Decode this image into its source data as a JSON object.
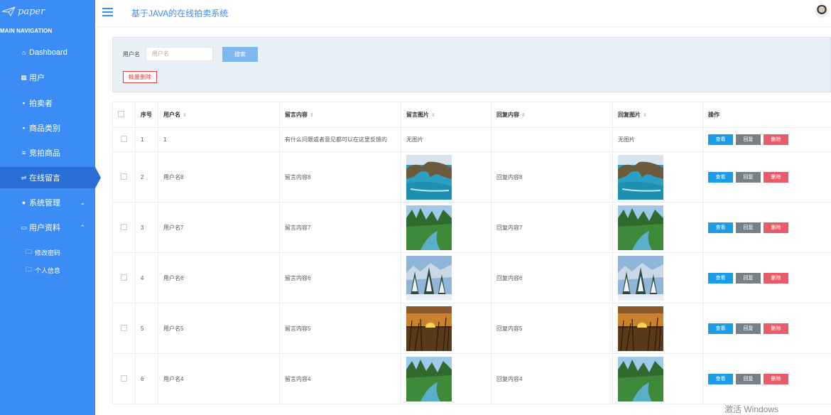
{
  "sidebar": {
    "logo": "paper",
    "heading": "MAIN NAVIGATION",
    "items": [
      {
        "label": "Dashboard",
        "icon": "home-icon"
      },
      {
        "label": "用户",
        "icon": "table-icon"
      },
      {
        "label": "拍卖者",
        "icon": "grid-icon"
      },
      {
        "label": "商品类别",
        "icon": "grid-icon"
      },
      {
        "label": "竞拍商品",
        "icon": "list-icon"
      },
      {
        "label": "在线留言",
        "icon": "sliders-icon"
      },
      {
        "label": "系统管理",
        "icon": "user-icon"
      },
      {
        "label": "用户资料",
        "icon": "calendar-icon"
      }
    ],
    "sub_items": [
      {
        "label": "修改密码",
        "icon": "folder-icon"
      },
      {
        "label": "个人信息",
        "icon": "folder-icon"
      }
    ]
  },
  "header": {
    "title": "基于JAVA的在线拍卖系统"
  },
  "search": {
    "label": "用户名",
    "placeholder": "用户名",
    "search_button": "搜索",
    "batch_delete_button": "批量删除"
  },
  "table": {
    "headers": {
      "index": "序号",
      "username": "用户名",
      "message": "留言内容",
      "message_image": "留言图片",
      "reply": "回复内容",
      "reply_image": "回复图片",
      "actions": "操作"
    },
    "no_image": "无图片",
    "buttons": {
      "view": "查看",
      "reply": "回复",
      "delete": "删除"
    },
    "rows": [
      {
        "index": "1",
        "username": "1",
        "message": "有什么问题或者意见都可以在这里反馈的",
        "message_image": "",
        "reply": "",
        "reply_image": ""
      },
      {
        "index": "2",
        "username": "用户名8",
        "message": "留言内容8",
        "message_image": "coast-rock-arch",
        "reply": "回复内容8",
        "reply_image": "coast-rock-arch"
      },
      {
        "index": "3",
        "username": "用户名7",
        "message": "留言内容7",
        "message_image": "forest-river",
        "reply": "回复内容7",
        "reply_image": "forest-river"
      },
      {
        "index": "4",
        "username": "用户名6",
        "message": "留言内容6",
        "message_image": "snowy-pines",
        "reply": "回复内容6",
        "reply_image": "snowy-pines"
      },
      {
        "index": "5",
        "username": "用户名5",
        "message": "留言内容5",
        "message_image": "sunset-grass",
        "reply": "回复内容5",
        "reply_image": "sunset-grass"
      },
      {
        "index": "6",
        "username": "用户名4",
        "message": "留言内容4",
        "message_image": "forest-river",
        "reply": "回复内容4",
        "reply_image": "forest-river"
      }
    ]
  },
  "watermark": "激活 Windows",
  "colors": {
    "sidebar": "#3c8cf5",
    "active": "#2a6fd6",
    "view": "#1a9ce8",
    "reply": "#777f87",
    "delete": "#e85b68"
  }
}
